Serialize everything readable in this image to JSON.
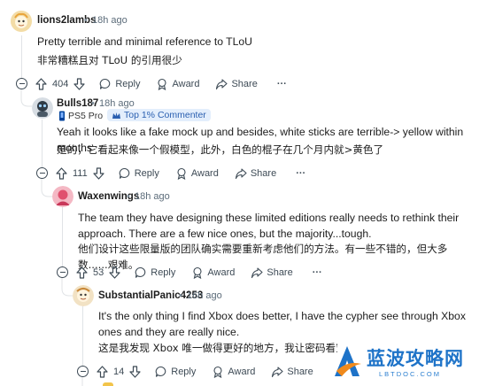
{
  "comments": [
    {
      "username": "lions2lambs",
      "separator": "•",
      "time": "18h ago",
      "text_en": "Pretty terrible and minimal reference to TLoU",
      "text_zh": "非常糟糕且对 TLoU 的引用很少",
      "votes": "404",
      "reply_label": "Reply",
      "award_label": "Award",
      "share_label": "Share",
      "more_label": "···"
    },
    {
      "username": "Bulls187",
      "separator": "•",
      "time": "18h ago",
      "flair_console": "PS5 Pro",
      "flair_badge": "Top 1% Commenter",
      "text_en": "Yeah it looks like a fake mock up and besides, white sticks are terrible-> yellow within months",
      "text_zh": "是的，它看起来像一个假模型，此外，白色的棍子在几个月内就>黄色了",
      "votes": "111",
      "reply_label": "Reply",
      "award_label": "Award",
      "share_label": "Share",
      "more_label": "···"
    },
    {
      "username": "Waxenwings",
      "separator": "•",
      "time": "18h ago",
      "text_en": "The team they have designing these limited editions really needs to rethink their approach. There are a few nice ones, but the majority...tough.",
      "text_zh": "他们设计这些限量版的团队确实需要重新考虑他们的方法。有一些不错的，但大多数......艰难。",
      "votes": "53",
      "reply_label": "Reply",
      "award_label": "Award",
      "share_label": "Share",
      "more_label": "···"
    },
    {
      "username": "SubstantialPanic4253",
      "separator": "•",
      "time": "16h ago",
      "text_en": "It's the only thing I find Xbox does better, I have the cypher see through Xbox ones and they are really nice.",
      "text_zh": "这是我发现 Xbox 唯一做得更好的地方，我让密码看穿",
      "votes": "14",
      "reply_label": "Reply",
      "award_label": "Award",
      "share_label": "Share"
    }
  ],
  "watermark": {
    "title": "蓝波攻略网",
    "subtitle": "LBTDOC.COM"
  },
  "colors": {
    "thread_line": "#e0e3e6",
    "text": "#1c1c1c",
    "meta": "#5c6c7a",
    "badge_bg": "#e3eefc",
    "badge_text": "#2a5fb0",
    "watermark_blue": "#1e73c8",
    "watermark_orange": "#f08a1c"
  }
}
